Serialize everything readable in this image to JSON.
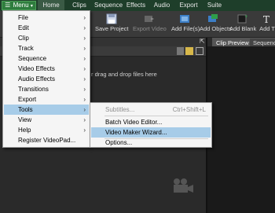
{
  "ribbon": {
    "menu_label": "Menu",
    "tabs": [
      "Home",
      "Clips",
      "Sequence",
      "Effects",
      "Audio",
      "Export",
      "Suite"
    ]
  },
  "toolbar": {
    "save_project": "Save Project",
    "export_video": "Export Video",
    "add_files": "Add File(s)",
    "add_objects": "Add Objects",
    "add_blank": "Add Blank",
    "add_text": "Add T"
  },
  "panels": {
    "clip_preview_tab": "Clip Preview",
    "sequence_tab": "Sequence",
    "drop_hint": "r drag and drop files here"
  },
  "main_menu": {
    "items": [
      {
        "label": "File",
        "accel": "F"
      },
      {
        "label": "Edit",
        "accel": "E"
      },
      {
        "label": "Clip",
        "accel": "C"
      },
      {
        "label": "Track",
        "accel": "T"
      },
      {
        "label": "Sequence",
        "accel": "S"
      },
      {
        "label": "Video Effects",
        "accel": "V"
      },
      {
        "label": "Audio Effects",
        "accel": "A"
      },
      {
        "label": "Transitions",
        "accel": "n"
      },
      {
        "label": "Export",
        "accel": "x"
      },
      {
        "label": "Tools",
        "accel": "T"
      },
      {
        "label": "View",
        "accel": "V"
      },
      {
        "label": "Help",
        "accel": "H"
      },
      {
        "label": "Register VideoPad..."
      }
    ],
    "selected": "Tools"
  },
  "tools_submenu": {
    "subtitles": {
      "label": "Subtitles...",
      "shortcut": "Ctrl+Shift+L"
    },
    "batch_video_editor": {
      "label": "Batch Video Editor..."
    },
    "video_maker_wizard": {
      "label": "Video Maker Wizard..."
    },
    "options": {
      "label": "Options..."
    }
  },
  "colors": {
    "menu_highlight": "#a7cce8",
    "ribbon_green": "#2f7d3e",
    "background": "#2b2b2b"
  }
}
